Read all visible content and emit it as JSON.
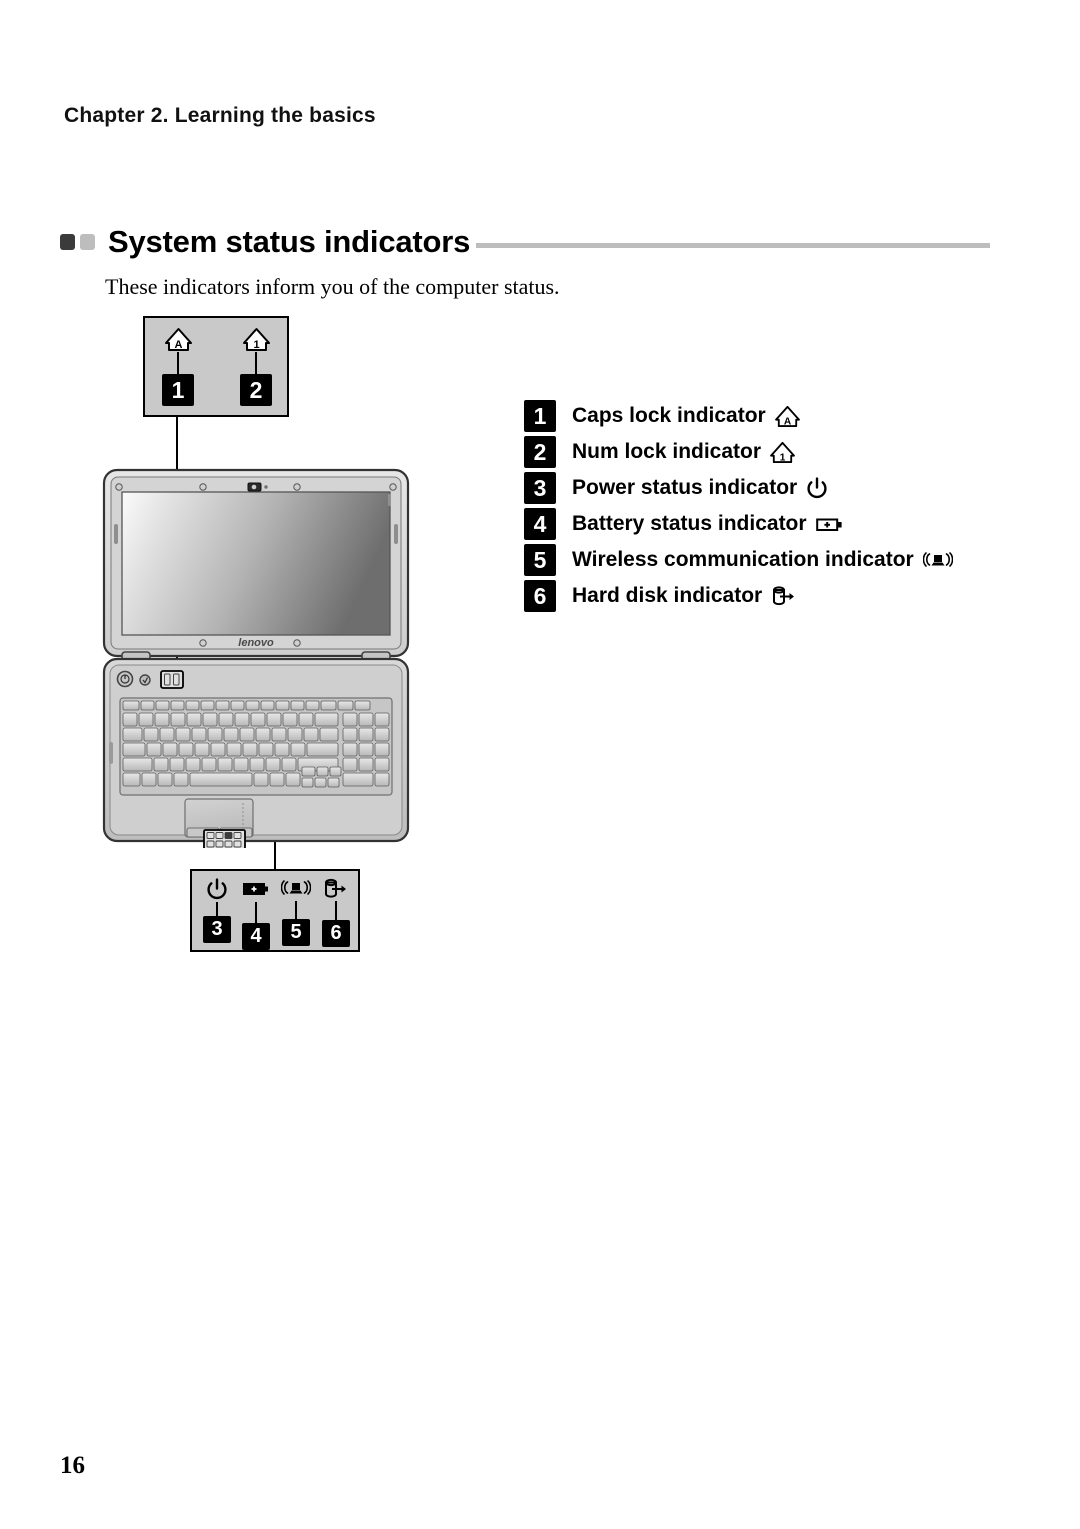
{
  "page": {
    "chapter_header": "Chapter 2. Learning the basics",
    "page_number": "16"
  },
  "section": {
    "title": "System status indicators",
    "intro": "These indicators inform you of the computer status.",
    "bullet_dark_color": "#3b3b3b",
    "bullet_light_color": "#bdbdbd",
    "rule_color": "#bdbdbd"
  },
  "callouts": {
    "top": {
      "name": "top-indicator-callout",
      "background": "#c9c9c9",
      "items": [
        {
          "number": "1",
          "icon": "caps-lock-icon"
        },
        {
          "number": "2",
          "icon": "num-lock-icon"
        }
      ]
    },
    "bottom": {
      "name": "bottom-indicator-callout",
      "background": "#c9c9c9",
      "items": [
        {
          "number": "3",
          "icon": "power-icon"
        },
        {
          "number": "4",
          "icon": "battery-icon"
        },
        {
          "number": "5",
          "icon": "wireless-icon"
        },
        {
          "number": "6",
          "icon": "hard-disk-icon"
        }
      ]
    }
  },
  "illustration": {
    "name": "lenovo-laptop-diagram",
    "brand_logo": "lenovo"
  },
  "legend": {
    "items": [
      {
        "number": "1",
        "label": "Caps lock indicator",
        "icon": "caps-lock-icon"
      },
      {
        "number": "2",
        "label": "Num lock indicator",
        "icon": "num-lock-icon"
      },
      {
        "number": "3",
        "label": "Power status indicator",
        "icon": "power-icon"
      },
      {
        "number": "4",
        "label": "Battery status indicator",
        "icon": "battery-icon"
      },
      {
        "number": "5",
        "label": "Wireless communication indicator",
        "icon": "wireless-icon"
      },
      {
        "number": "6",
        "label": "Hard disk indicator",
        "icon": "hard-disk-icon"
      }
    ]
  }
}
